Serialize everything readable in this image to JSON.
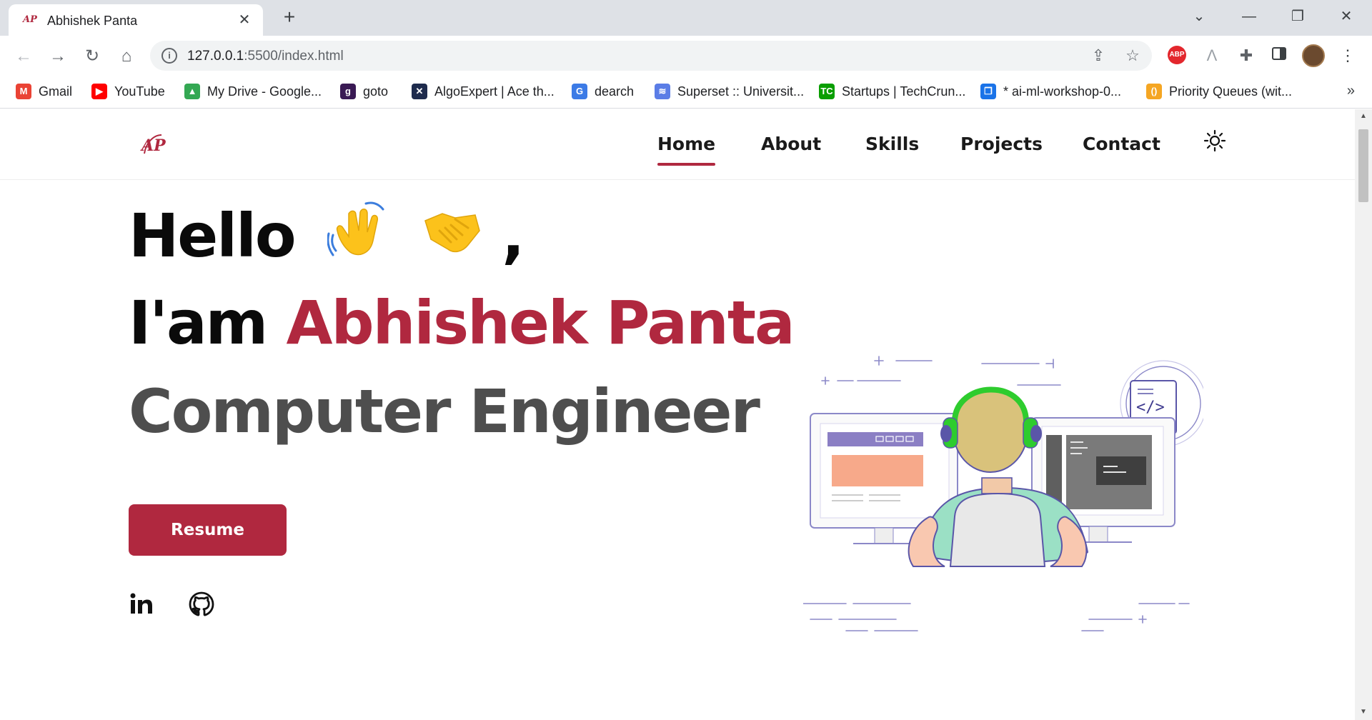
{
  "browser": {
    "tab_title": "Abhishek Panta",
    "tab_favicon_text": "AP",
    "url_host": "127.0.0.1",
    "url_rest": ":5500/index.html",
    "abp_label": "ABP",
    "bookmarks": [
      {
        "label": "Gmail",
        "icon": "gmail-icon",
        "color": "#ea4335",
        "glyph": "M"
      },
      {
        "label": "YouTube",
        "icon": "youtube-icon",
        "color": "#ff0000",
        "glyph": "▶"
      },
      {
        "label": "My Drive - Google...",
        "icon": "google-drive-icon",
        "color": "#34a853",
        "glyph": "▲"
      },
      {
        "label": "goto",
        "icon": "goto-icon",
        "color": "#3a1a54",
        "glyph": "g"
      },
      {
        "label": "AlgoExpert | Ace th...",
        "icon": "algoexpert-icon",
        "color": "#1e2b4d",
        "glyph": "✕"
      },
      {
        "label": "dearch",
        "icon": "dearch-icon",
        "color": "#3c7be6",
        "glyph": "G"
      },
      {
        "label": "Superset :: Universit...",
        "icon": "superset-icon",
        "color": "#5b7de6",
        "glyph": "≋"
      },
      {
        "label": "Startups | TechCrun...",
        "icon": "techcrunch-icon",
        "color": "#0a9e01",
        "glyph": "TC"
      },
      {
        "label": "* ai-ml-workshop-0...",
        "icon": "ai-ml-workshop-icon",
        "color": "#1a73e8",
        "glyph": "❐"
      },
      {
        "label": "Priority Queues (wit...",
        "icon": "priority-queues-icon",
        "color": "#f5a623",
        "glyph": "()"
      }
    ]
  },
  "site": {
    "logo_text": "AP",
    "nav": [
      {
        "label": "Home",
        "active": true
      },
      {
        "label": "About",
        "active": false
      },
      {
        "label": "Skills",
        "active": false
      },
      {
        "label": "Projects",
        "active": false
      },
      {
        "label": "Contact",
        "active": false
      }
    ],
    "hero": {
      "greeting": "Hello",
      "greeting_suffix": ",",
      "intro": "I'am",
      "name": "Abhishek Panta",
      "role": "Computer Engineer"
    },
    "resume_label": "Resume",
    "colors": {
      "accent": "#b0283f",
      "role_text": "#4e4e4e"
    }
  }
}
